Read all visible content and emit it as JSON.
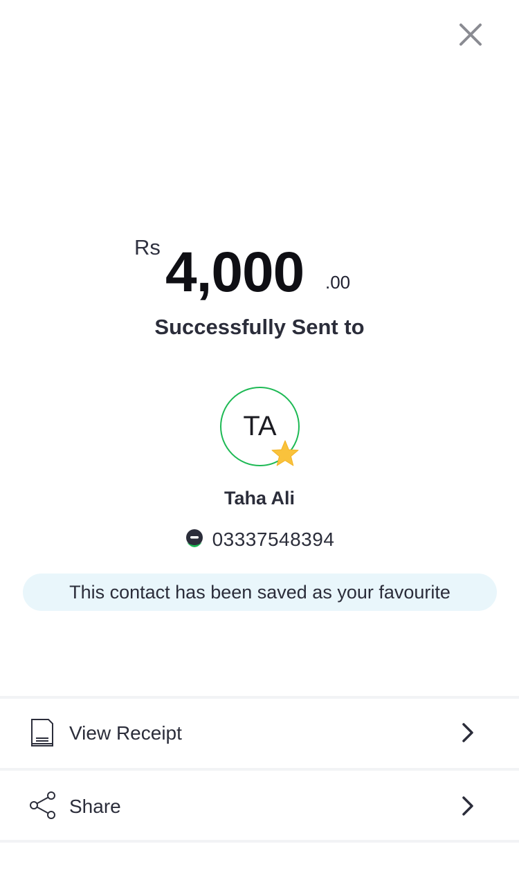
{
  "amount": {
    "currency": "Rs",
    "whole": "4,000",
    "decimal": ".00"
  },
  "status_text": "Successfully Sent to",
  "contact": {
    "initials": "TA",
    "name": "Taha Ali",
    "phone": "03337548394",
    "wallet_icon": "easypaisa-logo-icon",
    "favourite_icon": "star-icon"
  },
  "favourite_message": "This contact has been saved as your favourite",
  "actions": [
    {
      "label": "View Receipt",
      "icon": "receipt-icon"
    },
    {
      "label": "Share",
      "icon": "share-icon"
    }
  ],
  "colors": {
    "accent_green": "#1db954",
    "star": "#f9c23c",
    "banner_bg": "#e9f6fb",
    "text": "#2b2d3a"
  }
}
